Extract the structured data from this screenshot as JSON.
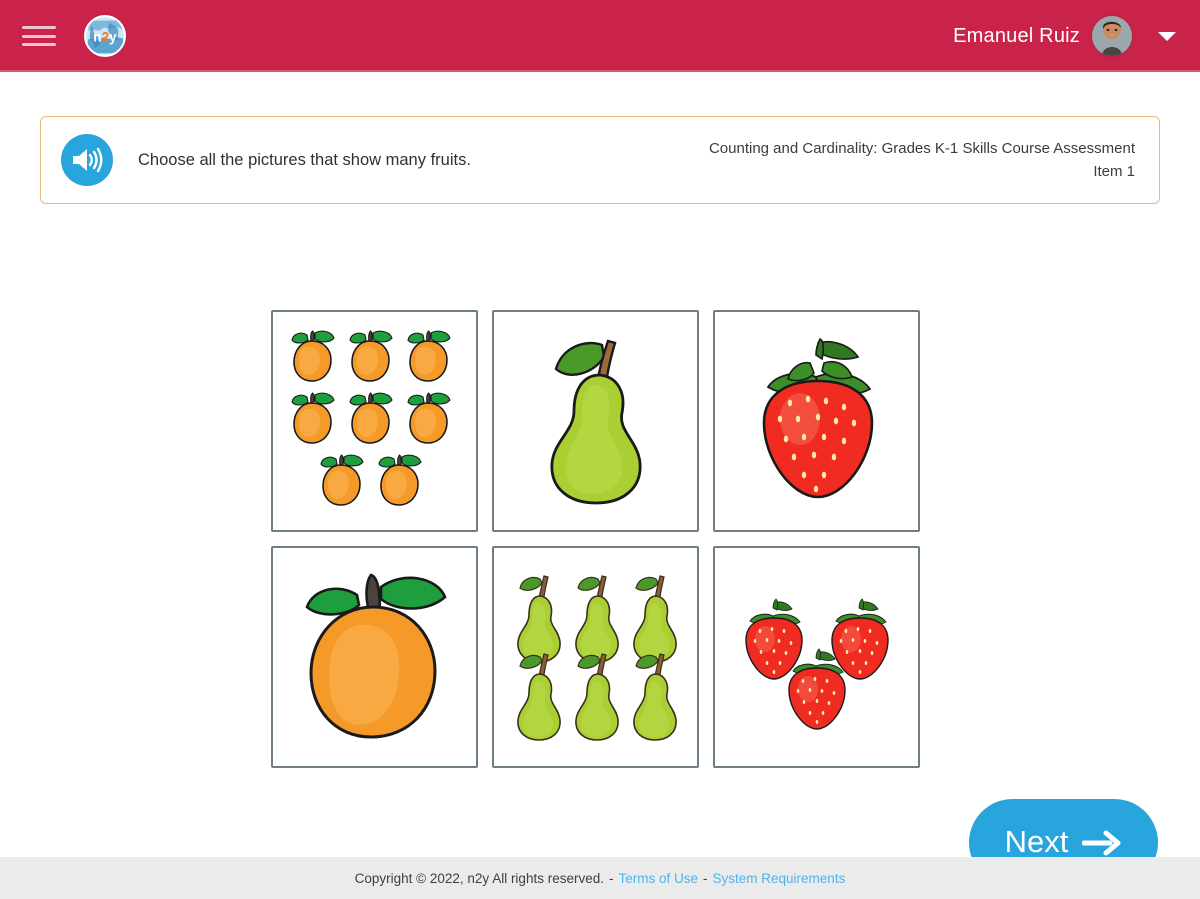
{
  "header": {
    "menu_icon": "hamburger-menu-icon",
    "logo_icon": "n2y-globe-logo",
    "logo_text": "n2y",
    "user_name": "Emanuel Ruiz",
    "avatar_icon": "user-avatar",
    "dropdown_icon": "chevron-down-icon",
    "background_color": "#c9234a"
  },
  "banner": {
    "speaker_icon": "speaker-audio-icon",
    "prompt": "Choose all the pictures that show many fruits.",
    "assessment_title": "Counting and Cardinality: Grades K-1 Skills Course Assessment",
    "item_label": "Item 1",
    "border_color": "#e7b87a",
    "accent_color": "#29a5dd"
  },
  "choices": [
    {
      "id": "choice-1",
      "icon": "mango-group-icon",
      "fruit": "mango",
      "count": 8,
      "label": "Eight mangoes",
      "selected": false
    },
    {
      "id": "choice-2",
      "icon": "pear-single-icon",
      "fruit": "pear",
      "count": 1,
      "label": "One pear",
      "selected": false
    },
    {
      "id": "choice-3",
      "icon": "strawberry-single-icon",
      "fruit": "strawberry",
      "count": 1,
      "label": "One strawberry",
      "selected": false
    },
    {
      "id": "choice-4",
      "icon": "mango-single-icon",
      "fruit": "mango",
      "count": 1,
      "label": "One mango",
      "selected": false
    },
    {
      "id": "choice-5",
      "icon": "pear-group-icon",
      "fruit": "pear",
      "count": 6,
      "label": "Six pears",
      "selected": false
    },
    {
      "id": "choice-6",
      "icon": "strawberry-group-icon",
      "fruit": "strawberry",
      "count": 3,
      "label": "Three strawberries",
      "selected": false
    }
  ],
  "next_button": {
    "label": "Next",
    "arrow_icon": "arrow-right-icon",
    "color": "#29a5dd"
  },
  "footer": {
    "copyright": "Copyright © 2022, n2y All rights reserved.",
    "separator_1": "-",
    "terms_link": "Terms of Use",
    "separator_2": "-",
    "requirements_link": "System Requirements",
    "link_color": "#4fb3e8"
  }
}
